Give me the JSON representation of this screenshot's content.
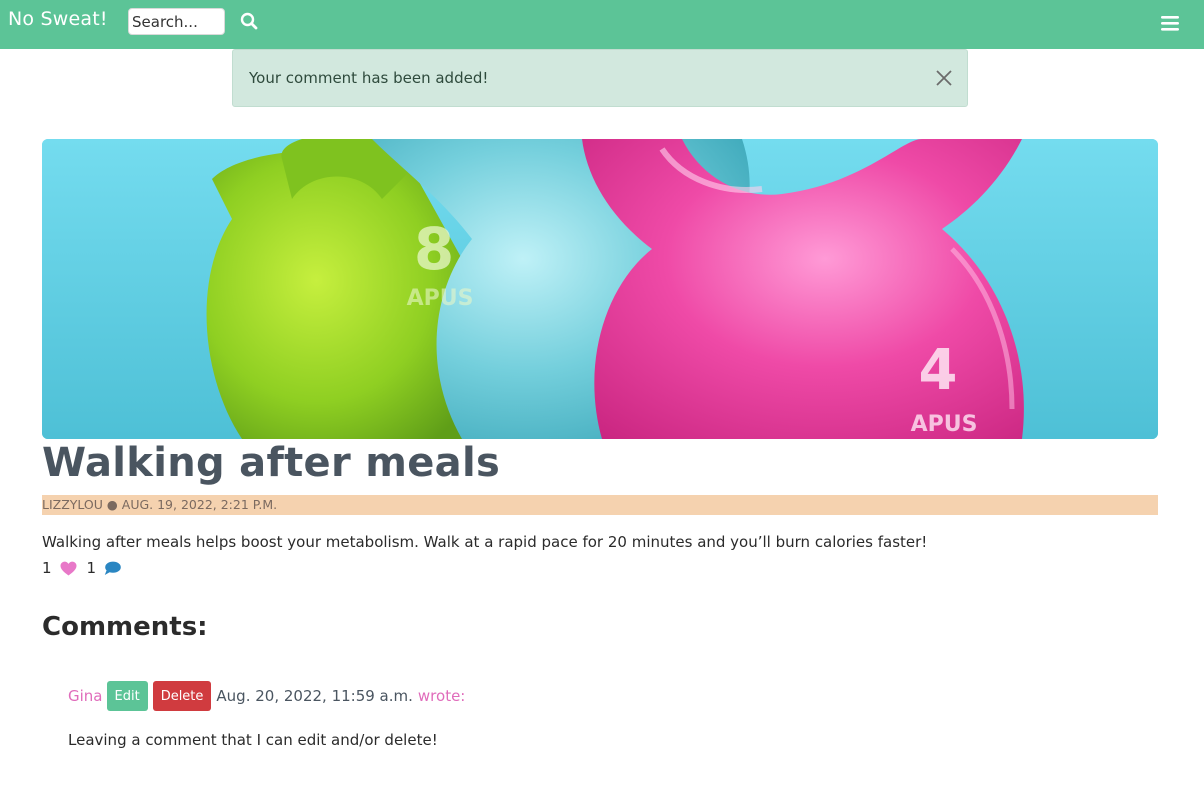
{
  "navbar": {
    "brand": "No Sweat!",
    "search_placeholder": "Search...",
    "icons": {
      "search": "search-icon",
      "menu": "hamburger-menu-icon"
    },
    "color": "#5cc497"
  },
  "alert": {
    "message": "Your comment has been added!",
    "close_icon": "close-icon"
  },
  "post": {
    "title": "Walking after meals",
    "meta": "LIZZYLOU ● AUG. 19, 2022, 2:21 P.M.",
    "body": "Walking after meals helps boost your metabolism. Walk at a rapid pace for 20 minutes and you’ll burn calories faster!",
    "like_count": "1",
    "comment_count": "1",
    "icons": {
      "like": "heart-icon",
      "comments": "comment-bubble-icon"
    }
  },
  "hero_image": {
    "kettlebell_labels": {
      "green": "8",
      "pink": "4"
    },
    "brand_mark": "APUS"
  },
  "comments": {
    "heading": "Comments:",
    "items": [
      {
        "author": "Gina",
        "edit_label": "Edit",
        "delete_label": "Delete",
        "date": "Aug. 20, 2022, 11:59 a.m.",
        "wrote": "wrote:",
        "body": "Leaving a comment that I can edit and/or delete!"
      }
    ]
  },
  "colors": {
    "accent": "#5cc497",
    "pink": "#e06cbb",
    "danger": "#d03b3f",
    "meta_bar": "#f5d2af",
    "alert_bg": "#d2e8de"
  }
}
